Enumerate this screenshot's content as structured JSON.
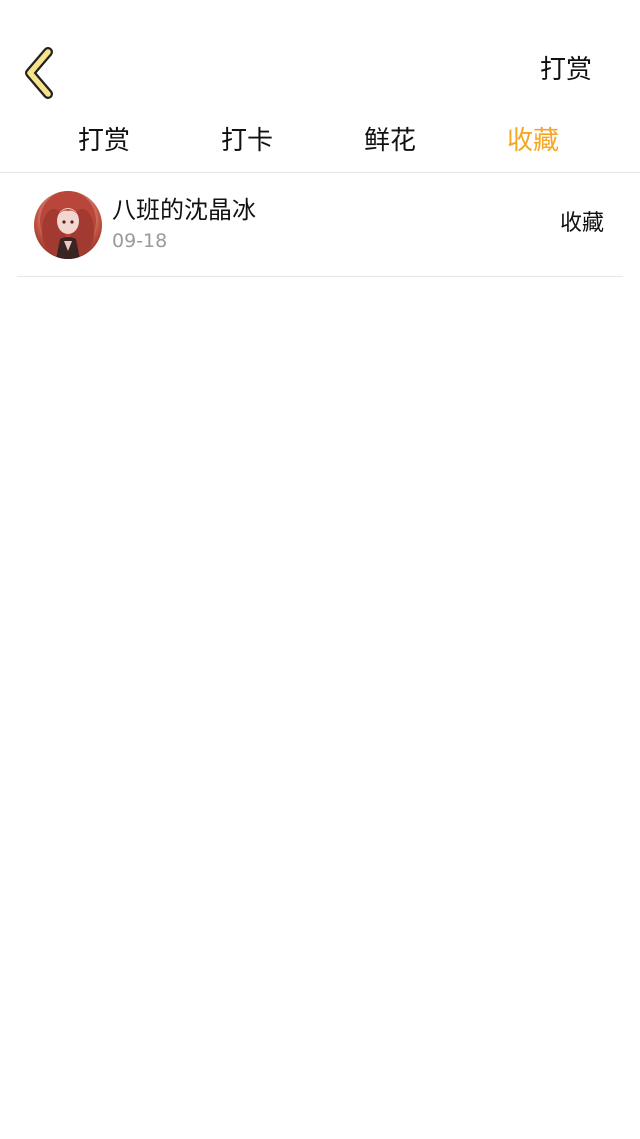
{
  "header": {
    "back_icon": "chevron-left-icon",
    "action_label": "打赏"
  },
  "tabs": [
    {
      "label": "打赏",
      "active": false
    },
    {
      "label": "打卡",
      "active": false
    },
    {
      "label": "鲜花",
      "active": false
    },
    {
      "label": "收藏",
      "active": true
    }
  ],
  "list": {
    "items": [
      {
        "name": "八班的沈晶冰",
        "date": "09-18",
        "type": "收藏",
        "avatar_icon": "user-avatar"
      }
    ]
  },
  "colors": {
    "accent": "#F5A623",
    "back_icon_fill": "#F7E48A",
    "text_primary": "#111111",
    "text_secondary": "#9A9A9A",
    "divider": "#E6E6E6",
    "background": "#FFFFFF"
  }
}
